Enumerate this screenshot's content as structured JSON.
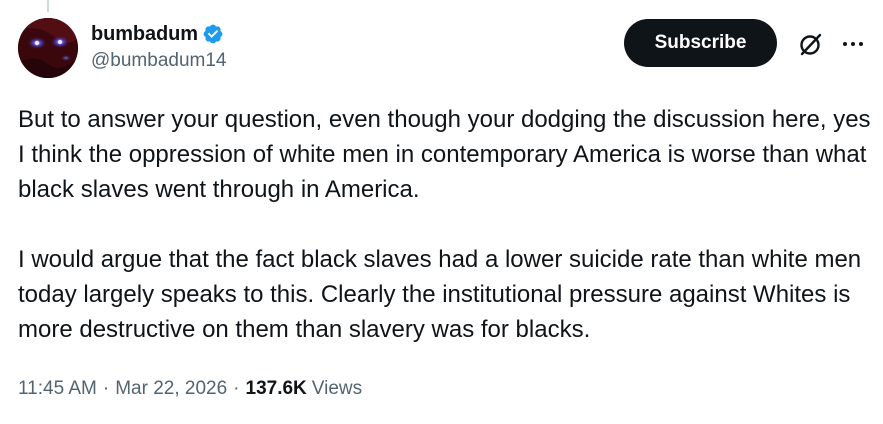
{
  "post": {
    "author": {
      "display_name": "bumbadum",
      "handle": "@bumbadum14",
      "verified": true,
      "avatar_icon": "avatar-icon"
    },
    "subscribe_label": "Subscribe",
    "grok_icon": "grok-icon",
    "more_icon": "more-icon",
    "paragraphs": [
      "But to answer your question, even though your dodging the discussion here, yes I think the oppression of white men in contemporary America is worse than what black slaves went through in America.",
      "I would argue that the fact black slaves had a lower suicide rate than white men today largely speaks to this. Clearly the institutional pressure against Whites is more destructive on them than slavery was for blacks."
    ],
    "time": "11:45 AM",
    "separator": "·",
    "date": "Mar 22, 2026",
    "views_count": "137.6K",
    "views_label": "Views"
  },
  "colors": {
    "text": "#0f1419",
    "secondary": "#536471",
    "verified": "#1d9bf0",
    "button_bg": "#0f1419"
  }
}
